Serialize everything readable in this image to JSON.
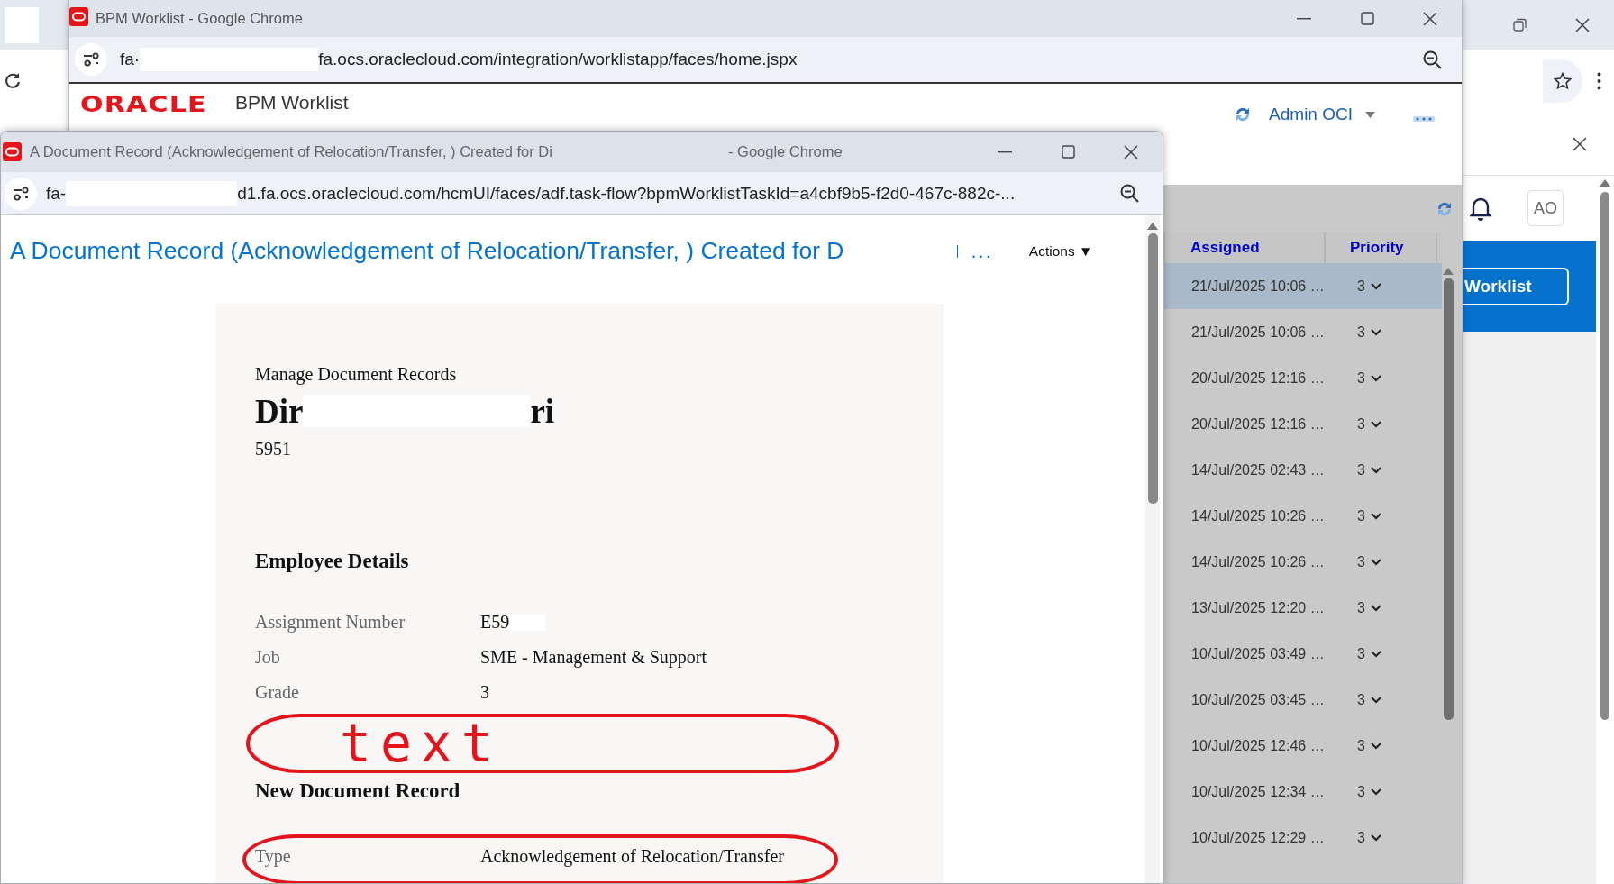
{
  "background_window": {
    "avatar": "AO",
    "nav_button": "Worklist"
  },
  "worklist_window": {
    "title": "BPM Worklist - Google Chrome",
    "url_start": "fa·",
    "url_rest": "fa.ocs.oraclecloud.com/integration/worklistapp/faces/home.jspx",
    "logo": "ORACLE",
    "app_title": "BPM Worklist",
    "user": "Admin OCI",
    "table": {
      "columns": [
        "Assigned",
        "Priority"
      ],
      "rows": [
        {
          "assigned": "21/Jul/2025 10:06 …",
          "priority": "3",
          "selected": true
        },
        {
          "assigned": "21/Jul/2025 10:06 …",
          "priority": "3",
          "selected": false
        },
        {
          "assigned": "20/Jul/2025 12:16 …",
          "priority": "3",
          "selected": false
        },
        {
          "assigned": "20/Jul/2025 12:16 …",
          "priority": "3",
          "selected": false
        },
        {
          "assigned": "14/Jul/2025 02:43 …",
          "priority": "3",
          "selected": false
        },
        {
          "assigned": "14/Jul/2025 10:26 …",
          "priority": "3",
          "selected": false
        },
        {
          "assigned": "14/Jul/2025 10:26 …",
          "priority": "3",
          "selected": false
        },
        {
          "assigned": "13/Jul/2025 12:20 …",
          "priority": "3",
          "selected": false
        },
        {
          "assigned": "10/Jul/2025 03:49 …",
          "priority": "3",
          "selected": false
        },
        {
          "assigned": "10/Jul/2025 03:45 …",
          "priority": "3",
          "selected": false
        },
        {
          "assigned": "10/Jul/2025 12:46 …",
          "priority": "3",
          "selected": false
        },
        {
          "assigned": "10/Jul/2025 12:34 …",
          "priority": "3",
          "selected": false
        },
        {
          "assigned": "10/Jul/2025 12:29 …",
          "priority": "3",
          "selected": false
        }
      ]
    }
  },
  "document_window": {
    "title": "A Document Record (Acknowledgement of Relocation/Transfer, ) Created for Di",
    "title_suffix": "- Google Chrome",
    "url_start": "fa-",
    "url_rest": "d1.fa.ocs.oraclecloud.com/hcmUI/faces/adf.task-flow?bpmWorklistTaskId=a4cbf9b5-f2d0-467c-882c-...",
    "heading": "A Document Record (Acknowledgement of Relocation/Transfer, ) Created for D",
    "more": "...",
    "actions": "Actions ▼",
    "record": {
      "breadcrumb": "Manage Document Records",
      "name_start": "Dir",
      "name_end": "ri",
      "person_number": "5951",
      "sections": [
        {
          "title": "Employee Details",
          "rows": [
            {
              "label": "Assignment Number",
              "value": "E59",
              "circled": false
            },
            {
              "label": "Job",
              "value": "SME - Management & Support",
              "circled": false
            },
            {
              "label": "Grade",
              "value": "3",
              "circled": false
            }
          ],
          "note": {
            "text": "text"
          }
        },
        {
          "title": "New Document Record",
          "rows": [
            {
              "label": "Type",
              "value": "Acknowledgement of Relocation/Transfer",
              "circled": true
            }
          ]
        }
      ]
    }
  }
}
